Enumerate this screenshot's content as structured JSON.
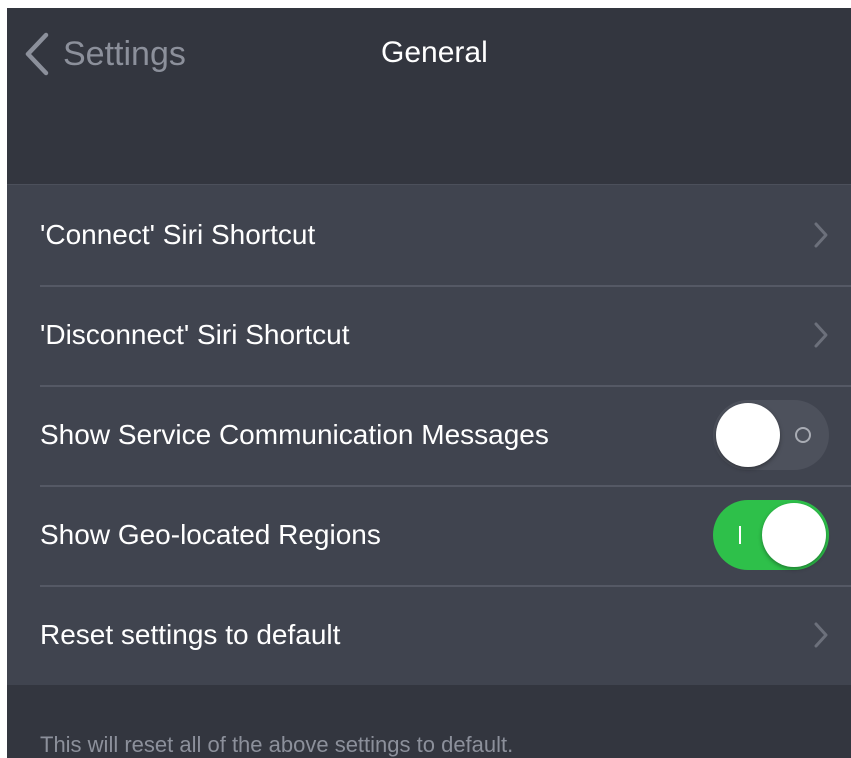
{
  "navbar": {
    "back_label": "Settings",
    "title": "General",
    "back_icon": "chevron-left-icon"
  },
  "settings": {
    "rows": [
      {
        "label": "'Connect' Siri Shortcut",
        "type": "disclosure"
      },
      {
        "label": "'Disconnect' Siri Shortcut",
        "type": "disclosure"
      },
      {
        "label": "Show Service Communication Messages",
        "type": "toggle",
        "value": false
      },
      {
        "label": "Show Geo-located Regions",
        "type": "toggle",
        "value": true
      },
      {
        "label": "Reset settings to default",
        "type": "disclosure"
      }
    ]
  },
  "footer": {
    "note": "This will reset all of the above settings to default."
  },
  "colors": {
    "background": "#33363f",
    "group": "#40444f",
    "toggle_on": "#2ec04a",
    "toggle_off": "#4d515c",
    "secondary_text": "#8c909b"
  }
}
